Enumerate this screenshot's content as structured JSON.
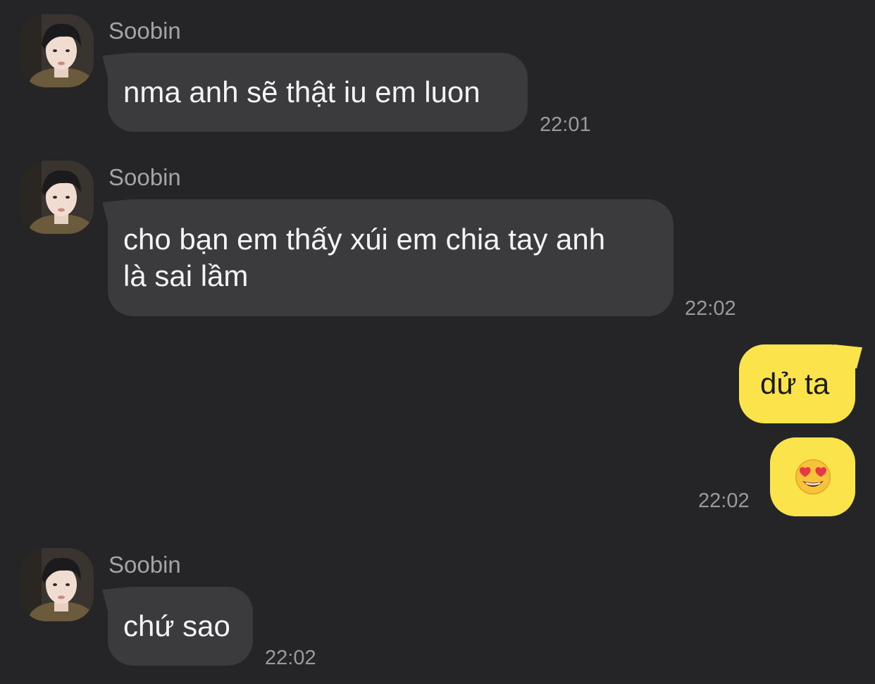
{
  "messages": [
    {
      "sender": "Soobin",
      "avatar_icon": "profile-photo",
      "lines": [
        "nma anh sẽ thật iu em luon"
      ],
      "time": "22:01"
    },
    {
      "sender": "Soobin",
      "avatar_icon": "profile-photo",
      "lines": [
        "cho bạn em thấy xúi em chia tay anh",
        "là sai lầm"
      ],
      "time": "22:02"
    },
    {
      "sender": "me",
      "lines": [
        "dử ta"
      ]
    },
    {
      "sender": "me",
      "emoji": "heart-eyes-emoji",
      "time": "22:02"
    },
    {
      "sender": "Soobin",
      "avatar_icon": "profile-photo",
      "lines": [
        "chứ sao"
      ],
      "time": "22:02"
    }
  ],
  "colors": {
    "background": "#252527",
    "incoming_bubble": "#3b3b3e",
    "outgoing_bubble": "#fbe34c",
    "sender_name": "#a4a4a7",
    "timestamp": "#9a9a9d"
  }
}
